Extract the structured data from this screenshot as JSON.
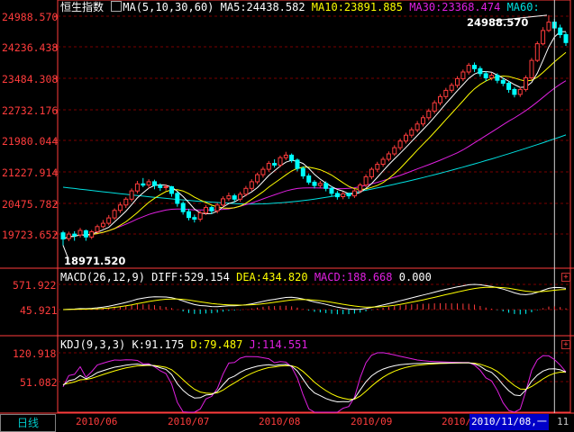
{
  "header": {
    "main_name": "恒生指数",
    "ma_spec": "MA(5,10,30,60)",
    "ma5": "MA5:24438.582",
    "ma10": "MA10:23891.885",
    "ma30": "MA30:23368.474",
    "ma60": "MA60:"
  },
  "macd_header": {
    "spec": "MACD(26,12,9)",
    "diff": "DIFF:529.154",
    "dea": "DEA:434.820",
    "macd": "MACD:188.668",
    "zero": "0.000"
  },
  "kdj_header": {
    "spec": "KDJ(9,3,3)",
    "k": "K:91.175",
    "d": "D:79.487",
    "j": "J:114.551"
  },
  "price_axis": [
    "24988.570",
    "24236.438",
    "23484.308",
    "22732.176",
    "21980.044",
    "21227.914",
    "20475.782",
    "19723.652"
  ],
  "macd_axis": [
    "571.922",
    "45.921"
  ],
  "kdj_axis": [
    "120.918",
    "51.082"
  ],
  "x_axis": [
    "2010/06",
    "2010/07",
    "2010/08",
    "2010/09",
    "2010/10"
  ],
  "annotations": {
    "high": "24988.570",
    "low": "18971.520"
  },
  "footer": {
    "period_tab": "日线",
    "cursor_date": "2010/11/08,一",
    "cursor_tail": "11"
  },
  "colors": {
    "up": "#ff3c3c",
    "down": "#00ffff",
    "ma5": "#ffffff",
    "ma10": "#ffff00",
    "ma30": "#e020e0",
    "ma60": "#00e0e0",
    "axis": "#ff3c3c",
    "grid": "#7a0000"
  },
  "chart_data": {
    "type": "candlestick",
    "series": [
      {
        "name": "恒生指数",
        "values": [
          [
            19750,
            19600,
            19800,
            19450
          ],
          [
            19610,
            19720,
            19780,
            19550
          ],
          [
            19720,
            19680,
            19790,
            19560
          ],
          [
            19700,
            19810,
            19870,
            19640
          ],
          [
            19800,
            19650,
            19830,
            19560
          ],
          [
            19650,
            19780,
            19820,
            19600
          ],
          [
            19780,
            19900,
            19950,
            19740
          ],
          [
            19900,
            19980,
            20060,
            19860
          ],
          [
            19980,
            20110,
            20180,
            19930
          ],
          [
            20110,
            20290,
            20340,
            20060
          ],
          [
            20290,
            20420,
            20490,
            20230
          ],
          [
            20420,
            20560,
            20610,
            20350
          ],
          [
            20560,
            20760,
            20820,
            20500
          ],
          [
            20760,
            20930,
            21000,
            20700
          ],
          [
            20930,
            20900,
            21070,
            20850
          ],
          [
            20900,
            20980,
            21040,
            20820
          ],
          [
            20980,
            20890,
            21030,
            20800
          ],
          [
            20890,
            20840,
            20940,
            20760
          ],
          [
            20840,
            20860,
            20920,
            20770
          ],
          [
            20860,
            20700,
            20880,
            20620
          ],
          [
            20700,
            20460,
            20740,
            20380
          ],
          [
            20460,
            20260,
            20510,
            20190
          ],
          [
            20260,
            20120,
            20330,
            20050
          ],
          [
            20120,
            20080,
            20190,
            20000
          ],
          [
            20080,
            20230,
            20280,
            20020
          ],
          [
            20230,
            20360,
            20420,
            20180
          ],
          [
            20360,
            20280,
            20400,
            20200
          ],
          [
            20280,
            20420,
            20470,
            20220
          ],
          [
            20420,
            20570,
            20630,
            20370
          ],
          [
            20570,
            20640,
            20720,
            20520
          ],
          [
            20640,
            20560,
            20690,
            20490
          ],
          [
            20560,
            20680,
            20740,
            20500
          ],
          [
            20680,
            20820,
            20880,
            20630
          ],
          [
            20820,
            20980,
            21040,
            20760
          ],
          [
            20980,
            21150,
            21200,
            20920
          ],
          [
            21150,
            21280,
            21340,
            21080
          ],
          [
            21280,
            21420,
            21480,
            21220
          ],
          [
            21420,
            21380,
            21520,
            21320
          ],
          [
            21380,
            21560,
            21610,
            21330
          ],
          [
            21560,
            21620,
            21700,
            21500
          ],
          [
            21620,
            21500,
            21660,
            21440
          ],
          [
            21500,
            21300,
            21540,
            21230
          ],
          [
            21300,
            21120,
            21350,
            21050
          ],
          [
            21120,
            20970,
            21180,
            20910
          ],
          [
            20970,
            20890,
            21020,
            20820
          ],
          [
            20890,
            20940,
            21000,
            20830
          ],
          [
            20940,
            20820,
            20990,
            20750
          ],
          [
            20820,
            20700,
            20870,
            20630
          ],
          [
            20700,
            20620,
            20760,
            20550
          ],
          [
            20620,
            20690,
            20740,
            20560
          ],
          [
            20690,
            20640,
            20720,
            20570
          ],
          [
            20640,
            20760,
            20810,
            20590
          ],
          [
            20760,
            20900,
            20950,
            20710
          ],
          [
            20900,
            21100,
            21160,
            20850
          ],
          [
            21100,
            21280,
            21330,
            21040
          ],
          [
            21280,
            21400,
            21460,
            21220
          ],
          [
            21400,
            21520,
            21580,
            21340
          ],
          [
            21520,
            21650,
            21710,
            21470
          ],
          [
            21650,
            21800,
            21860,
            21600
          ],
          [
            21800,
            21960,
            22020,
            21740
          ],
          [
            21960,
            22100,
            22160,
            21900
          ],
          [
            22100,
            22230,
            22290,
            22040
          ],
          [
            22230,
            22370,
            22440,
            22170
          ],
          [
            22370,
            22520,
            22580,
            22310
          ],
          [
            22520,
            22680,
            22740,
            22460
          ],
          [
            22680,
            22880,
            22940,
            22620
          ],
          [
            22880,
            23030,
            23090,
            22820
          ],
          [
            23030,
            23180,
            23240,
            22970
          ],
          [
            23180,
            23300,
            23360,
            23120
          ],
          [
            23300,
            23460,
            23520,
            23240
          ],
          [
            23460,
            23620,
            23680,
            23400
          ],
          [
            23620,
            23780,
            23840,
            23560
          ],
          [
            23780,
            23700,
            23850,
            23620
          ],
          [
            23700,
            23580,
            23760,
            23510
          ],
          [
            23580,
            23480,
            23640,
            23400
          ],
          [
            23480,
            23540,
            23600,
            23420
          ],
          [
            23540,
            23420,
            23590,
            23350
          ],
          [
            23420,
            23350,
            23480,
            23280
          ],
          [
            23350,
            23200,
            23400,
            23120
          ],
          [
            23200,
            23080,
            23250,
            23010
          ],
          [
            23080,
            23200,
            23260,
            23020
          ],
          [
            23200,
            23480,
            23540,
            23150
          ],
          [
            23480,
            23900,
            23960,
            23430
          ],
          [
            23900,
            24300,
            24360,
            23860
          ],
          [
            24300,
            24620,
            24700,
            24260
          ],
          [
            24620,
            24820,
            24988.57,
            24580
          ],
          [
            24820,
            24680,
            24900,
            24600
          ],
          [
            24680,
            24520,
            24760,
            24440
          ],
          [
            24520,
            24330,
            24580,
            24250
          ]
        ]
      }
    ],
    "xlabel": "",
    "ylabel": "",
    "ylim": [
      18900,
      25050
    ],
    "grid": true,
    "legend": "none"
  }
}
